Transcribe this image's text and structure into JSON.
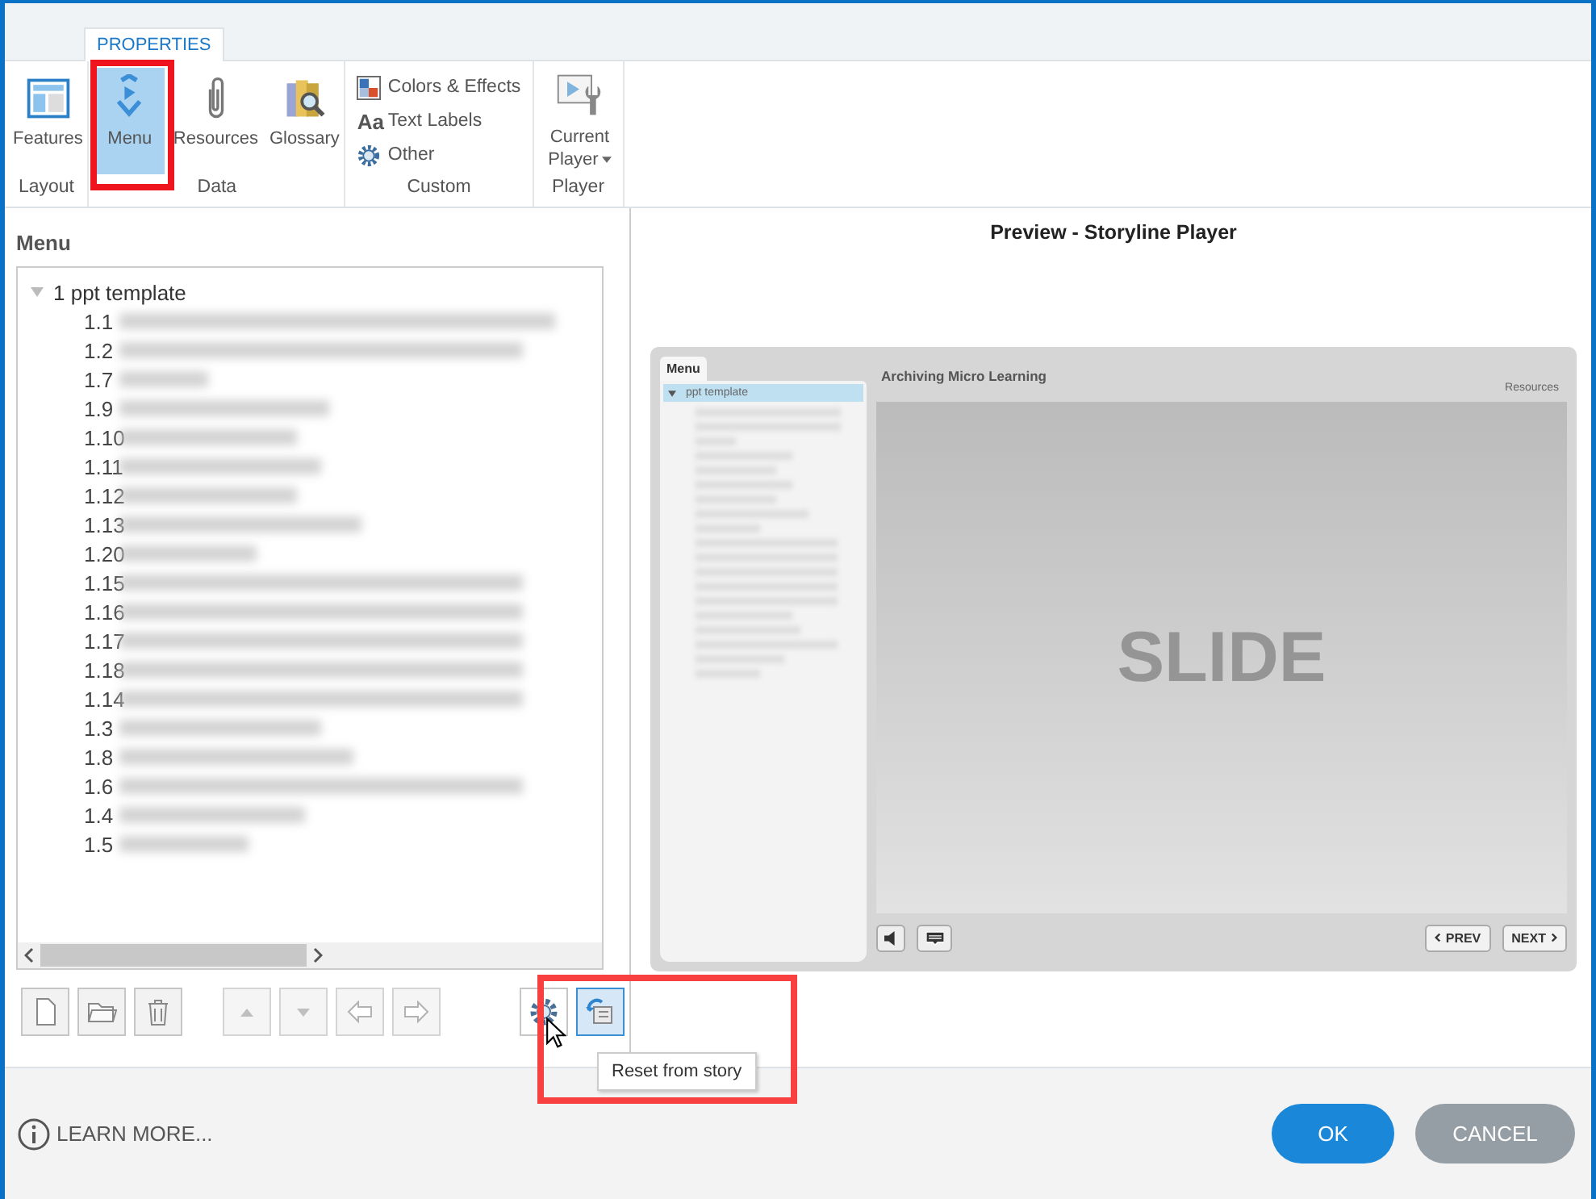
{
  "ribbon": {
    "tab": {
      "label": "PROPERTIES",
      "selected": true
    },
    "groups": [
      {
        "label": "Layout",
        "items": [
          {
            "kind": "large",
            "label": "Features",
            "selected": false
          }
        ]
      },
      {
        "label": "Data",
        "items": [
          {
            "kind": "large",
            "label": "Menu",
            "selected": true
          },
          {
            "kind": "large",
            "label": "Resources",
            "selected": false
          },
          {
            "kind": "large",
            "label": "Glossary",
            "selected": false
          }
        ]
      },
      {
        "label": "Custom",
        "items": [
          {
            "kind": "small",
            "label": "Colors & Effects"
          },
          {
            "kind": "small",
            "label": "Text Labels",
            "glyph": "Aa"
          },
          {
            "kind": "small",
            "label": "Other"
          }
        ]
      },
      {
        "label": "Player",
        "items": [
          {
            "kind": "dropdown",
            "label": "Current",
            "label2": "Player"
          }
        ]
      }
    ]
  },
  "menu": {
    "heading": "Menu",
    "tree": {
      "label": "1 ppt template",
      "expanded": true,
      "children": [
        {
          "number": "1.1"
        },
        {
          "number": "1.2"
        },
        {
          "number": "1.7"
        },
        {
          "number": "1.9"
        },
        {
          "number": "1.10"
        },
        {
          "number": "1.11"
        },
        {
          "number": "1.12"
        },
        {
          "number": "1.13"
        },
        {
          "number": "1.20"
        },
        {
          "number": "1.15"
        },
        {
          "number": "1.16"
        },
        {
          "number": "1.17"
        },
        {
          "number": "1.18"
        },
        {
          "number": "1.14"
        },
        {
          "number": "1.3"
        },
        {
          "number": "1.8"
        },
        {
          "number": "1.6"
        },
        {
          "number": "1.4"
        },
        {
          "number": "1.5"
        }
      ]
    }
  },
  "toolbar": [
    {
      "disabled": false,
      "hovered": false
    },
    {
      "disabled": false,
      "hovered": false
    },
    {
      "disabled": false,
      "hovered": false
    },
    {
      "disabled": true,
      "hovered": false
    },
    {
      "disabled": true,
      "hovered": false
    },
    {
      "disabled": true,
      "hovered": false
    },
    {
      "disabled": true,
      "hovered": false
    },
    {
      "disabled": false,
      "hovered": false
    },
    {
      "disabled": false,
      "hovered": true
    }
  ],
  "tooltip": "Reset from story",
  "preview": {
    "heading": "Preview - Storyline Player",
    "menu_tab": "Menu",
    "tree_root": {
      "label": "ppt template",
      "selected": true
    },
    "course_title": "Archiving Micro Learning",
    "resources": "Resources",
    "slide": "SLIDE",
    "prev": "PREV",
    "next": "NEXT"
  },
  "footer": {
    "learn_more": "LEARN MORE...",
    "ok": "OK",
    "cancel": "CANCEL"
  }
}
